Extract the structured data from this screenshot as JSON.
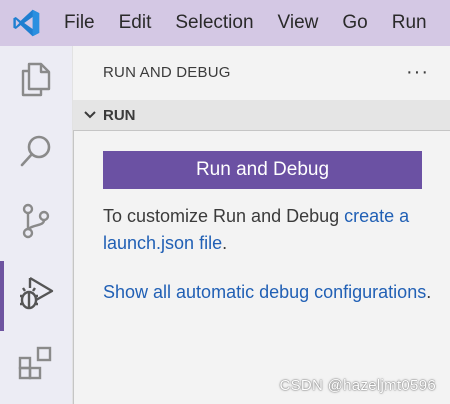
{
  "menubar": {
    "items": [
      "File",
      "Edit",
      "Selection",
      "View",
      "Go",
      "Run"
    ]
  },
  "activity_bar": {
    "items": [
      {
        "icon": "files-icon",
        "active": false
      },
      {
        "icon": "search-icon",
        "active": false
      },
      {
        "icon": "source-control-icon",
        "active": false
      },
      {
        "icon": "run-debug-icon",
        "active": true
      },
      {
        "icon": "extensions-icon",
        "active": false
      }
    ]
  },
  "sidebar": {
    "title": "RUN AND DEBUG",
    "more_label": "···",
    "section": {
      "title": "RUN",
      "button_label": "Run and Debug",
      "text1_prefix": "To customize Run and Debug ",
      "text1_link": "create a launch.json file",
      "text1_suffix": ".",
      "text2_link": "Show all automatic debug configurations",
      "text2_suffix": "."
    }
  },
  "watermark": "CSDN @hazeljmt0596",
  "colors": {
    "accent": "#6b51a3",
    "titlebar": "#d4c8e4",
    "link": "#2160b5"
  }
}
